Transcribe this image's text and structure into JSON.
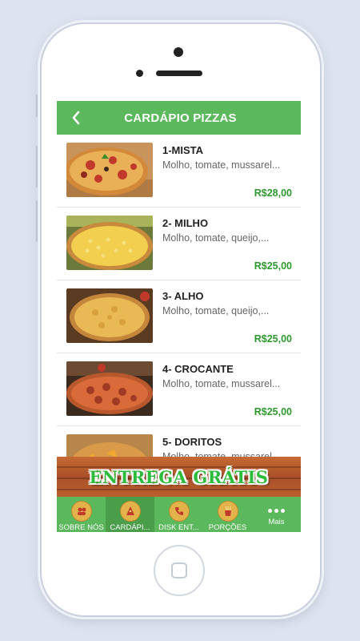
{
  "header": {
    "title": "CARDÁPIO PIZZAS",
    "back_icon": "chevron-left-icon"
  },
  "items": [
    {
      "name": "1-MISTA",
      "desc": "Molho, tomate, mussarel...",
      "price": "R$28,00"
    },
    {
      "name": "2- MILHO",
      "desc": "Molho, tomate, queijo,...",
      "price": "R$25,00"
    },
    {
      "name": "3- ALHO",
      "desc": "Molho, tomate, queijo,...",
      "price": "R$25,00"
    },
    {
      "name": "4- CROCANTE",
      "desc": "Molho, tomate, mussarel...",
      "price": "R$25,00"
    },
    {
      "name": "5- DORITOS",
      "desc": "Molho, tomate, mussarel...",
      "price": ""
    }
  ],
  "banner": {
    "text": "ENTREGA GRÁTIS"
  },
  "nav": [
    {
      "label": "SOBRE NÓS",
      "icon": "people-icon"
    },
    {
      "label": "CARDÁPI...",
      "icon": "pizza-slice-icon"
    },
    {
      "label": "DISK ENT...",
      "icon": "phone-icon"
    },
    {
      "label": "PORÇÕES",
      "icon": "fries-icon"
    },
    {
      "label": "Mais",
      "icon": "more-dots-icon"
    }
  ],
  "colors": {
    "accent": "#5cb85c",
    "price": "#2e9a2e",
    "banner_text": "#2dbb3c",
    "banner_wood": "#b55a2c"
  }
}
